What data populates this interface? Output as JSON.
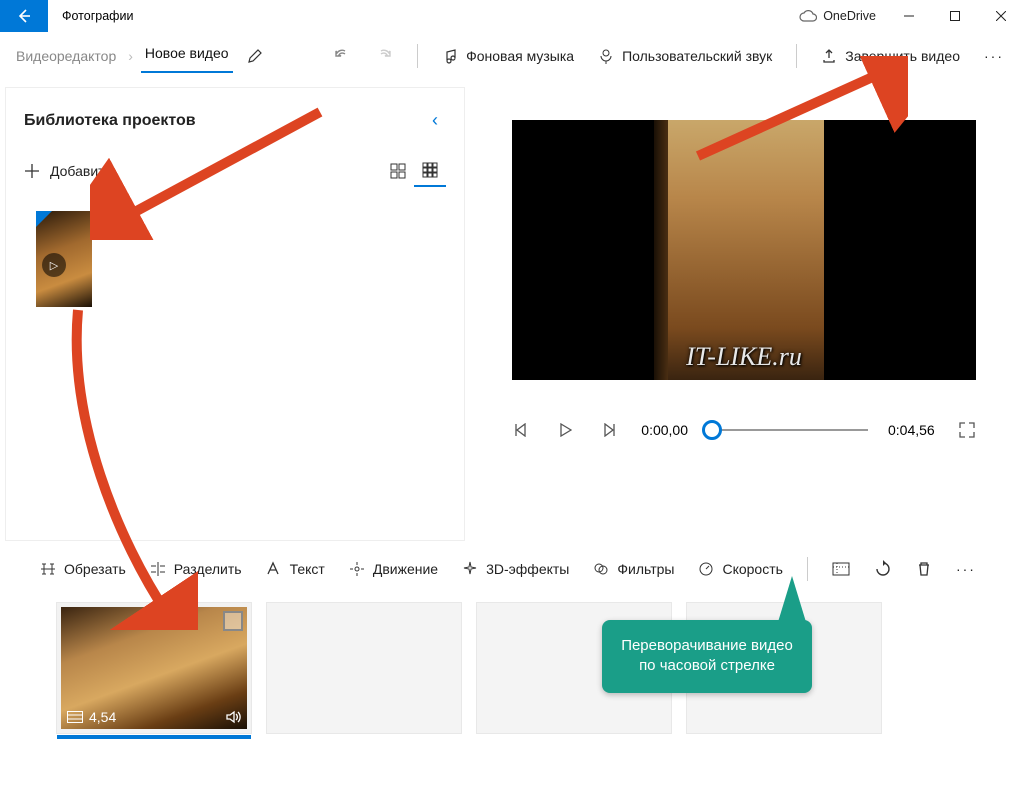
{
  "titlebar": {
    "app": "Фотографии",
    "onedrive": "OneDrive"
  },
  "toolbar": {
    "crumb": "Видеоредактор",
    "project": "Новое видео",
    "bg_music": "Фоновая музыка",
    "custom_audio": "Пользовательский звук",
    "finish": "Завершить видео"
  },
  "library": {
    "title": "Библиотека проектов",
    "add": "Добавить"
  },
  "player": {
    "current": "0:00,00",
    "total": "0:04,56"
  },
  "edit": {
    "trim": "Обрезать",
    "split": "Разделить",
    "text": "Текст",
    "motion": "Движение",
    "effects3d": "3D-эффекты",
    "filters": "Фильтры",
    "speed": "Скорость"
  },
  "clip": {
    "duration": "4,54"
  },
  "watermark": "IT-LIKE.ru",
  "callout": "Переворачивание видео по часовой стрелке"
}
